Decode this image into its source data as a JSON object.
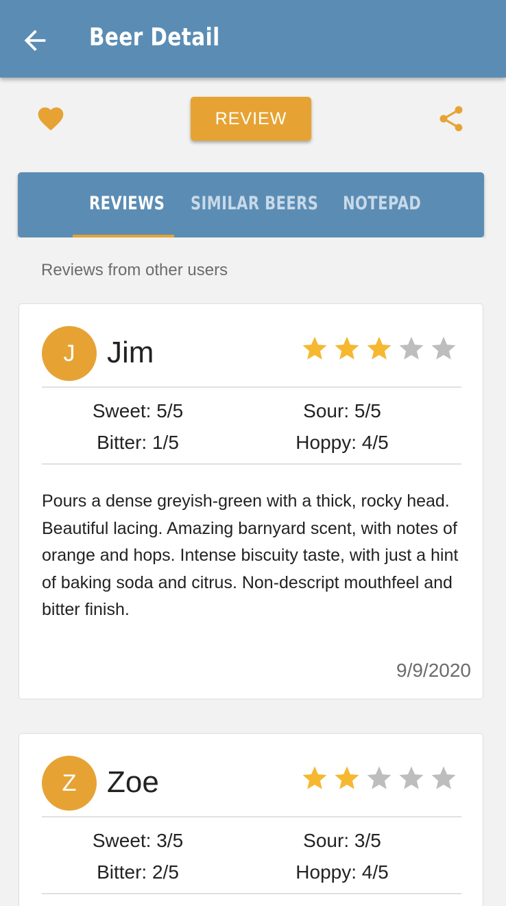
{
  "app_bar": {
    "title": "Beer Detail",
    "back_icon": "arrow-left-icon"
  },
  "actions": {
    "favorite_icon": "heart-icon",
    "review_label": "REVIEW",
    "share_icon": "share-icon"
  },
  "tabs": [
    {
      "label": "REVIEWS",
      "active": true
    },
    {
      "label": "SIMILAR BEERS",
      "active": false
    },
    {
      "label": "NOTEPAD",
      "active": false
    }
  ],
  "section_label": "Reviews from other users",
  "reviews": [
    {
      "initial": "J",
      "name": "Jim",
      "rating": 3,
      "max_rating": 5,
      "sweet": "Sweet: 5/5",
      "sour": "Sour: 5/5",
      "bitter": "Bitter: 1/5",
      "hoppy": "Hoppy: 4/5",
      "text": "Pours a dense greyish-green with a thick, rocky head. Beautiful lacing. Amazing barnyard scent, with notes of orange and hops. Intense biscuity taste, with just a hint of baking soda and citrus. Non-descript mouthfeel and bitter finish.",
      "date": "9/9/2020"
    },
    {
      "initial": "Z",
      "name": "Zoe",
      "rating": 2,
      "max_rating": 5,
      "sweet": "Sweet: 3/5",
      "sour": "Sour: 3/5",
      "bitter": "Bitter: 2/5",
      "hoppy": "Hoppy: 4/5"
    }
  ],
  "colors": {
    "primary": "#5b8db4",
    "accent": "#e6a334",
    "star_filled": "#f5b830",
    "star_empty": "#bdbdbd"
  }
}
